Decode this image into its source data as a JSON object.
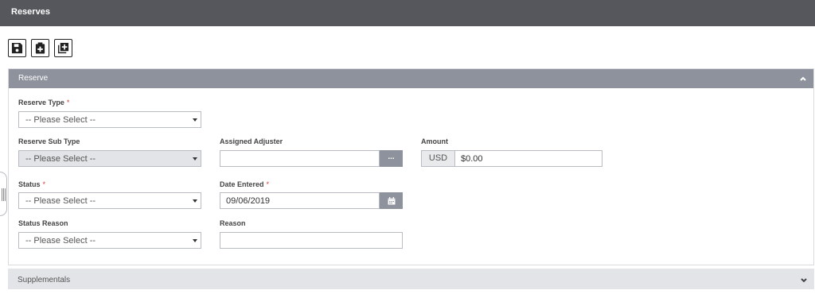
{
  "header": {
    "title": "Reserves"
  },
  "toolbar": {
    "buttons": [
      {
        "icon": "save-icon"
      },
      {
        "icon": "clipboard-add-icon"
      },
      {
        "icon": "copy-add-icon"
      }
    ]
  },
  "reserve_panel": {
    "title": "Reserve",
    "fields": {
      "reserve_type": {
        "label": "Reserve Type",
        "required_mark": "*",
        "value": "-- Please Select --"
      },
      "reserve_sub_type": {
        "label": "Reserve Sub Type",
        "value": "-- Please Select --",
        "disabled": true
      },
      "assigned_adjuster": {
        "label": "Assigned Adjuster",
        "value": "",
        "button_label": "..."
      },
      "amount": {
        "label": "Amount",
        "currency": "USD",
        "value": "$0.00"
      },
      "status": {
        "label": "Status",
        "required_mark": "*",
        "value": "-- Please Select --"
      },
      "date_entered": {
        "label": "Date Entered",
        "required_mark": "*",
        "value": "09/06/2019"
      },
      "status_reason": {
        "label": "Status Reason",
        "value": "-- Please Select --"
      },
      "reason": {
        "label": "Reason",
        "value": ""
      }
    }
  },
  "supplementals_panel": {
    "title": "Supplementals"
  },
  "colors": {
    "topbar": "#55575c",
    "panel_header": "#8e929c",
    "required": "#d13c3c"
  }
}
